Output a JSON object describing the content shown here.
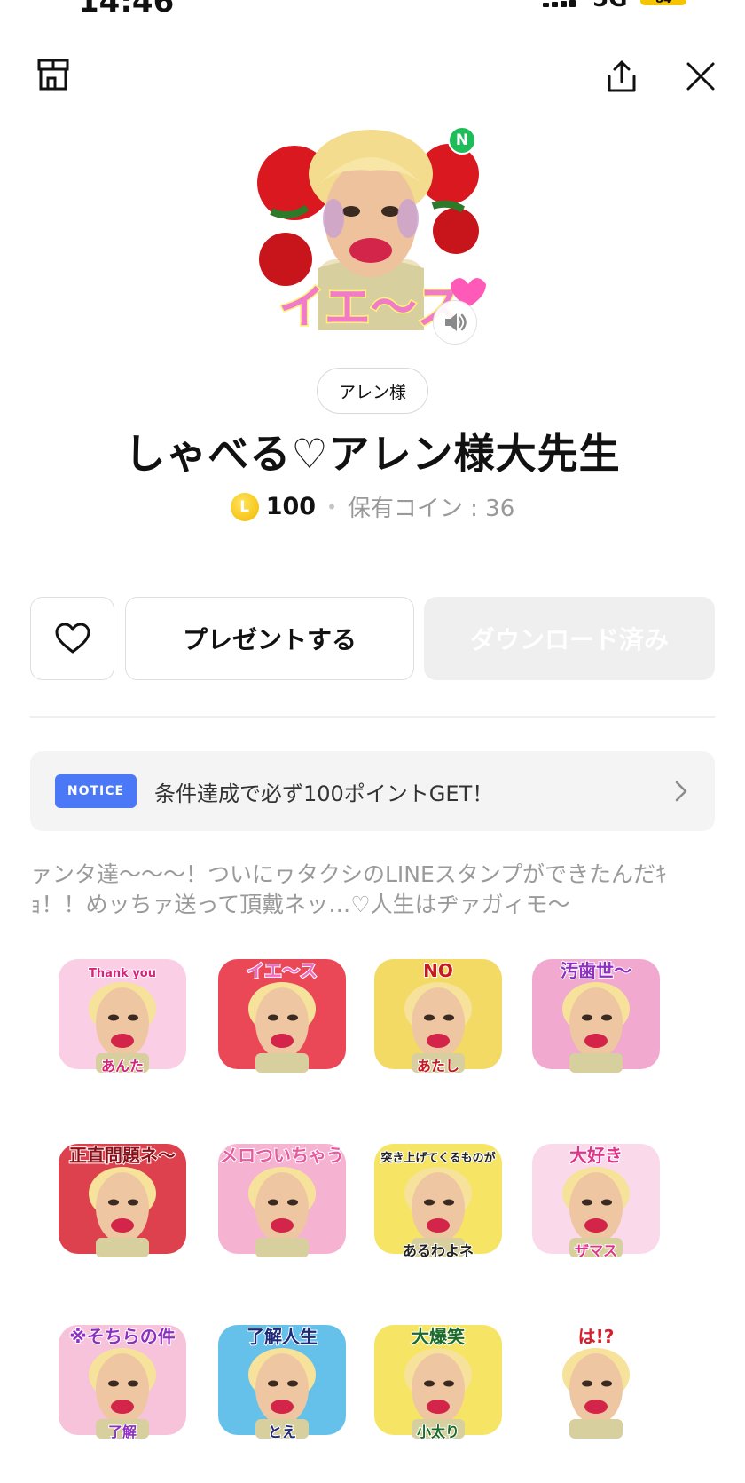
{
  "status": {
    "time": "14:46",
    "network": "5G",
    "battery": "84"
  },
  "header": {
    "shop_icon": "shop-icon",
    "share_icon": "share-icon",
    "close_icon": "close-icon"
  },
  "hero": {
    "badge": "N",
    "sound_icon": "speaker-icon"
  },
  "author": "アレン様",
  "title": "しゃべる♡アレン様大先生",
  "price": {
    "coin_symbol": "L",
    "amount": "100",
    "separator": "•",
    "owned": "保有コイン : 36"
  },
  "actions": {
    "favorite_icon": "heart-icon",
    "gift_label": "プレゼントする",
    "download_label": "ダウンロード済み"
  },
  "notice": {
    "tag": "NOTICE",
    "text": "条件達成で必ず100ポイントGET！"
  },
  "description": "ァンタ達〜〜〜！ついにヮタクシのLINEスタンプができたんだｷｮ！！めッちァ送って頂戴ネッ…♡人生はヂァガィモ〜",
  "stickers": [
    {
      "caption": "Thank you",
      "sub": "あんた",
      "bg": "#f9c6e0",
      "accent": "#d6247b"
    },
    {
      "caption": "イエ〜ス",
      "sub": "",
      "bg": "#e8283a",
      "accent": "#f06bc0"
    },
    {
      "caption": "NO",
      "sub": "あたし",
      "bg": "#f1d44a",
      "accent": "#c7191f"
    },
    {
      "caption": "汚歯世〜",
      "sub": "",
      "bg": "#ef9ac8",
      "accent": "#8e2fc2"
    },
    {
      "caption": "正直問題ネ〜",
      "sub": "",
      "bg": "#d7202e",
      "accent": "#8a0f18"
    },
    {
      "caption": "メロついちゃう",
      "sub": "",
      "bg": "#f5a6c9",
      "accent": "#e85a9f"
    },
    {
      "caption": "突き上げてくるものが",
      "sub": "あるわよネ",
      "bg": "#f4e04a",
      "accent": "#222222"
    },
    {
      "caption": "大好き",
      "sub": "ザマス",
      "bg": "#f9d3e6",
      "accent": "#e0338a"
    },
    {
      "caption": "※そちらの件",
      "sub": "了解",
      "bg": "#f6b9d4",
      "accent": "#8e2fc2"
    },
    {
      "caption": "了解人生",
      "sub": "とえ",
      "bg": "#4ab6e6",
      "accent": "#1e2a7a"
    },
    {
      "caption": "大爆笑",
      "sub": "小太り",
      "bg": "#f4e04a",
      "accent": "#1b6b2a"
    },
    {
      "caption": "は!?",
      "sub": "",
      "bg": "#ffffff",
      "accent": "#d81e2a"
    }
  ]
}
